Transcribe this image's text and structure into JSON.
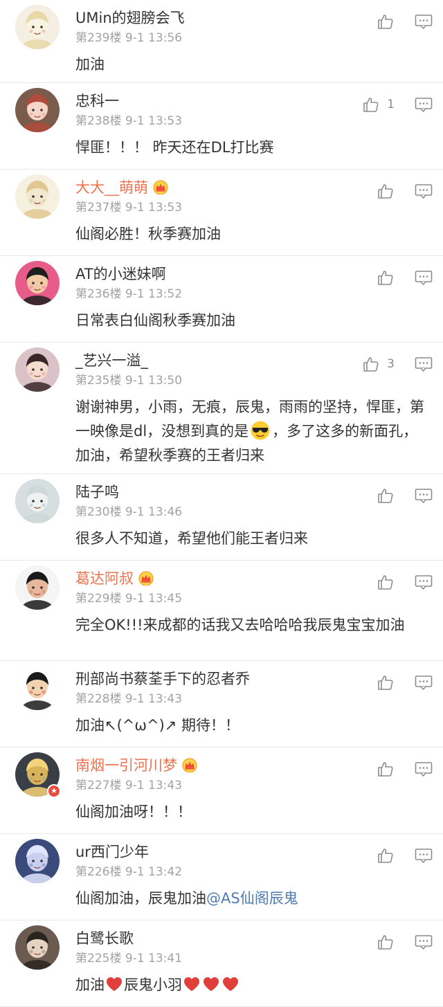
{
  "colors": {
    "vip_name": "#eb7350",
    "mention": "#507daf",
    "text": "#333333",
    "meta": "#a2a2a2",
    "heart": "#e0403b",
    "divider": "#e8e8e8"
  },
  "icons": {
    "like": "thumb-up-icon",
    "reply": "comment-bubble-icon",
    "crown": "crown-icon",
    "heart": "heart-icon"
  },
  "comments": [
    {
      "name": "UMin的翅膀会飞",
      "vip": false,
      "floor": "第239楼",
      "time": "9-1 13:56",
      "likes": "",
      "text": [
        {
          "t": "加油"
        }
      ]
    },
    {
      "name": "忠科一",
      "vip": false,
      "floor": "第238楼",
      "time": "9-1 13:53",
      "likes": "1",
      "text": [
        {
          "t": "悍匪！！！ 昨天还在DL打比赛"
        }
      ]
    },
    {
      "name": "大大__萌萌",
      "vip": true,
      "floor": "第237楼",
      "time": "9-1 13:53",
      "likes": "",
      "text": [
        {
          "t": "仙阁必胜！秋季赛加油"
        }
      ]
    },
    {
      "name": "AT的小迷妹啊",
      "vip": false,
      "floor": "第236楼",
      "time": "9-1 13:52",
      "likes": "",
      "text": [
        {
          "t": "日常表白仙阁秋季赛加油"
        }
      ]
    },
    {
      "name": "_艺兴一溢_",
      "vip": false,
      "floor": "第235楼",
      "time": "9-1 13:50",
      "likes": "3",
      "text": [
        {
          "t": "谢谢神男，小雨，无痕，辰鬼，雨雨的坚持，悍匪，第一映像是dl，没想到真的是"
        },
        {
          "emoji": "cool"
        },
        {
          "t": "，多了这多的新面孔，加油，希望秋季赛的王者归来"
        }
      ]
    },
    {
      "name": "陆子鸣",
      "vip": false,
      "floor": "第230楼",
      "time": "9-1 13:46",
      "likes": "",
      "text": [
        {
          "t": "很多人不知道，希望他们能王者归来"
        }
      ]
    },
    {
      "name": "葛达阿叔",
      "vip": true,
      "floor": "第229楼",
      "time": "9-1 13:45",
      "likes": "",
      "text": [
        {
          "t": "完全OK!!!来成都的话我又去哈哈哈我辰鬼宝宝加油"
        }
      ]
    },
    {
      "name": "刑部尚书蔡荃手下的忍者乔",
      "vip": false,
      "floor": "第228楼",
      "time": "9-1 13:43",
      "likes": "",
      "text": [
        {
          "t": "加油↖(^ω^)↗ 期待！！"
        }
      ]
    },
    {
      "name": "南烟一引河川梦",
      "vip": true,
      "floor": "第227楼",
      "time": "9-1 13:43",
      "likes": "",
      "badge": "★",
      "text": [
        {
          "t": "仙阁加油呀！！！"
        }
      ]
    },
    {
      "name": "ur西门少年",
      "vip": false,
      "floor": "第226楼",
      "time": "9-1 13:42",
      "likes": "",
      "text": [
        {
          "t": "仙阁加油，辰鬼加油"
        },
        {
          "mention": "@AS仙阁辰鬼"
        }
      ]
    },
    {
      "name": "白鹭长歌",
      "vip": false,
      "floor": "第225楼",
      "time": "9-1 13:41",
      "likes": "",
      "text": [
        {
          "t": "加油"
        },
        {
          "heart": true
        },
        {
          "t": "辰鬼小羽"
        },
        {
          "heart": true
        },
        {
          "heart": true
        },
        {
          "heart": true
        }
      ]
    }
  ]
}
